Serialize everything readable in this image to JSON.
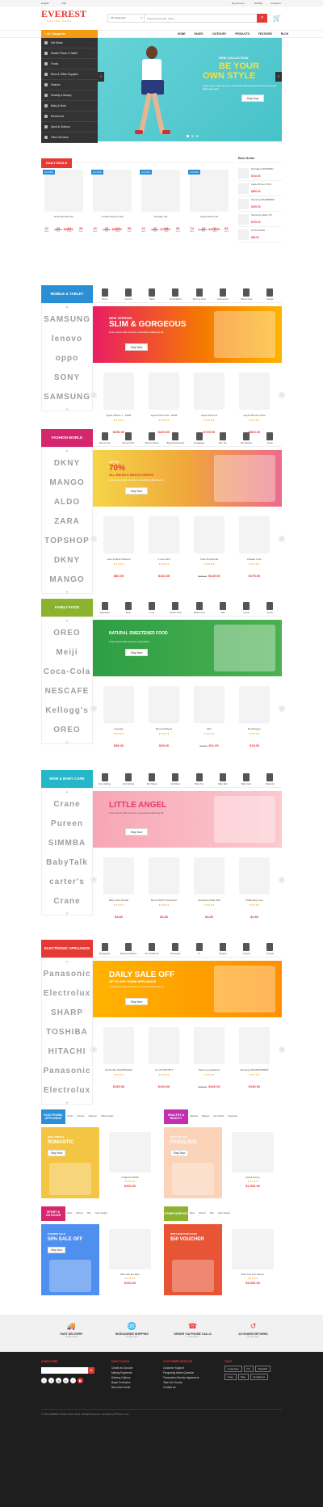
{
  "topbar": {
    "language": "English",
    "currency": "USD",
    "my_account": "My Account",
    "wishlist": "Wishlist",
    "checkout": "Checkout"
  },
  "header": {
    "logo": "EVEREST",
    "logo_sub": "ONLINE SHOP",
    "category_select": "All Categories",
    "search_placeholder": "Keyword here item name..."
  },
  "nav": {
    "all_categories": "All Categories",
    "links": [
      "HOME",
      "PAGES",
      "CATEGORY",
      "PRODUCTS",
      "FEATURES",
      "BLOG"
    ]
  },
  "sidebar": [
    "Hot Deals",
    "Mobile Phone & Tablet",
    "Foods",
    "Book & Office Supplies",
    "Fashion",
    "Healthy & Beauty",
    "Baby & Mom",
    "Electronics",
    "Sport & Outdoor",
    "Other Services"
  ],
  "hero": {
    "kicker": "NEW COLLECTION",
    "title1": "BE YOUR",
    "title2": "OWN STYLE",
    "desc": "Lorem ipsum dolor sit amet, consectetur adipiscing elit. Aenean commodo ligula eget dolor.",
    "button": "Shop Now"
  },
  "daily": {
    "title": "DAILY DEALS",
    "items": [
      {
        "badge": "Cut 15%",
        "name": "Embroidered Polo",
        "old": "$90.00",
        "price": "$85.00",
        "timer": [
          "21",
          "23",
          "34",
          "56"
        ]
      },
      {
        "badge": "Cut 15%",
        "name": "2 Pack Gobermental",
        "old": "$90.00",
        "price": "$85.00",
        "timer": [
          "21",
          "23",
          "34",
          "56"
        ]
      },
      {
        "badge": "Cut 15%",
        "name": "Si Rigby Cat",
        "old": "$90.00",
        "price": "$75.00",
        "timer": [
          "21",
          "23",
          "34",
          "56"
        ]
      },
      {
        "badge": "Cut 15%",
        "name": "Apple iPhone 6S",
        "old": "$190.00",
        "price": "$115.00",
        "timer": [
          "74",
          "23",
          "34",
          "56"
        ]
      }
    ],
    "timer_labels": [
      "Days",
      "Hrs",
      "Mins",
      "Secs"
    ]
  },
  "bestseller": {
    "title": "Best Seller",
    "items": [
      {
        "name": "LB Gallery IPS295IM2",
        "price": "$740.00"
      },
      {
        "name": "Apple iPhone 6 Plus",
        "price": "$890.00"
      },
      {
        "name": "Samsung RF29EBEBR",
        "price": "$190.00"
      },
      {
        "name": "Samsung Galaxy S6",
        "price": "$720.00"
      },
      {
        "name": "HP 32 INKED",
        "price": "$89.00"
      }
    ]
  },
  "sections": [
    {
      "key": "mobile",
      "title": "MOBILE & TABLET",
      "color": "#2b8fd6",
      "cats": [
        "Phone",
        "Android",
        "Tablet",
        "Smart Watch",
        "Memory Card",
        "Accessories",
        "Phone Case",
        "Gadget"
      ],
      "brands": [
        "SAMSUNG",
        "lenovo",
        "oppo",
        "SONY",
        "SAMSUNG"
      ],
      "banner": {
        "kicker": "NEW VERSION",
        "title": "SLIM & GORGEOUS",
        "desc": "Lorem ipsum dolor sit amet, consectetur adipiscing elit.",
        "button": "Shop Now"
      },
      "products": [
        {
          "name": "Apple iPhone 7 - 16GB",
          "old": "",
          "price": "$350.00"
        },
        {
          "name": "Apple iPhone 6S - 16GB",
          "old": "",
          "price": "$420.00"
        },
        {
          "name": "Apple iPhone 6",
          "old": "",
          "price": "$725.00"
        },
        {
          "name": "Apple iPhone 6 Plus",
          "old": "",
          "price": "$860.00"
        }
      ]
    },
    {
      "key": "fashion",
      "title": "FASHION WORLD",
      "color": "#d6266e",
      "cats": [
        "Women Top",
        "Women Pant",
        "Women Shoes",
        "Bag & Accessories",
        "Sunglasses",
        "Men Top",
        "Men Bottom",
        "Dress"
      ],
      "brands": [
        "DKNY",
        "MANGO",
        "ALDO",
        "ZARA",
        "TOPSHOP",
        "DKNY",
        "MANGO"
      ],
      "banner": {
        "kicker": "UP TO",
        "title": "70%",
        "sub": "ALL BIKINI & BEACH DRESS",
        "desc": "Lorem ipsum dolor sit amet, consectetur adipiscing elit.",
        "button": "Shop Now"
      },
      "products": [
        {
          "name": "Lace & Mesh Patterns",
          "old": "",
          "price": "$80.00"
        },
        {
          "name": "A Line Skirt",
          "old": "",
          "price": "$110.00"
        },
        {
          "name": "Crab Printed Hat",
          "old": "$150.00",
          "price": "$149.00"
        },
        {
          "name": "Pleated Front",
          "old": "",
          "price": "$175.00"
        }
      ]
    },
    {
      "key": "food",
      "title": "FAMILY FOOD",
      "color": "#8bb32e",
      "cats": [
        "Vegetables",
        "Meat",
        "Fruit",
        "Frozen Food",
        "Bread Food",
        "Milk",
        "Candy",
        "Snack"
      ],
      "brands": [
        "OREO",
        "Meiji",
        "Coca-Cola",
        "NESCAFE",
        "Kellogg's",
        "OREO"
      ],
      "banner": {
        "kicker": "",
        "title": "NATURAL SWEETENED FOOD",
        "desc": "Lorem ipsum dolor sit amet, consectetur.",
        "button": "Shop Now"
      },
      "products": [
        {
          "name": "Avocado",
          "old": "",
          "price": "$58.00"
        },
        {
          "name": "Broccoli Bread",
          "old": "",
          "price": "$45.00"
        },
        {
          "name": "Mint",
          "old": "$19.00",
          "price": "$11.00"
        },
        {
          "name": "Red Pepper",
          "old": "",
          "price": "$15.00"
        }
      ]
    },
    {
      "key": "baby",
      "title": "MOM & BABY CARE",
      "color": "#26b6c9",
      "cats": [
        "Boy Clothing",
        "Girl Clothing",
        "Boy Shoes",
        "Girl Shoes",
        "Baby Toy",
        "Baby Bed",
        "Baby Care",
        "Maternity"
      ],
      "brands": [
        "Crane",
        "Pureen",
        "SIMMBA",
        "BabyTalk",
        "carter's",
        "Crane"
      ],
      "banner": {
        "kicker": "",
        "title": "LITTLE ANGEL",
        "desc": "Lorem ipsum dolor sit amet, consectetur adipiscing elit.",
        "button": "Shop Now"
      },
      "products": [
        {
          "name": "Baby Girls Sandal",
          "old": "",
          "price": "$4.80"
        },
        {
          "name": "Men's PRINT Swimshort",
          "old": "",
          "price": "$4.80"
        },
        {
          "name": "Grandpa's Plaid Shirt",
          "old": "",
          "price": "$4.80"
        },
        {
          "name": "Plaids Boys Tee",
          "old": "",
          "price": "$4.80"
        }
      ]
    },
    {
      "key": "electronic",
      "title": "ELECTRONIC APPLIANCE",
      "color": "#e53935",
      "cats": [
        "Refrigerator",
        "Washing Machine",
        "Air Conditioner",
        "Microwave",
        "TV",
        "Speaker",
        "Camera",
        "Console"
      ],
      "brands": [
        "Panasonic",
        "Electrolux",
        "SHARP",
        "TOSHIBA",
        "HITACHI",
        "Panasonic",
        "Electrolux"
      ],
      "banner": {
        "kicker": "",
        "title": "DAILY SALE OFF",
        "sub": "UP TO 20% HOME APPLIANCE",
        "desc": "Lorem ipsum dolor sit amet, consectetur adipiscing elit.",
        "button": "Shop Now"
      },
      "products": [
        {
          "name": "GE Profile PFE28RSHSS",
          "old": "",
          "price": "$190.00"
        },
        {
          "name": "LG LFX25978ST",
          "old": "",
          "price": "$190.00"
        },
        {
          "name": "Samsung Appliance",
          "old": "$480.00",
          "price": "$400.00"
        },
        {
          "name": "Samsung RF28HFEDBSR",
          "old": "",
          "price": "$190.00"
        }
      ]
    }
  ],
  "minis": [
    {
      "title": "ELECTRONIC APPLIANCE",
      "color": "#2b8fd6",
      "tabs": [
        "Comic",
        "Science",
        "Stationer",
        "Office Supply"
      ],
      "bkick": "NEW ARRIVAL",
      "btitle": "ROMANTIC",
      "bbtn": "Shop Now",
      "bg": "#f4c542",
      "prod": "Organizer BCIB",
      "price": "$160.00"
    },
    {
      "title": "HEALTHY & BEAUTY",
      "color": "#c22fb0",
      "tabs": [
        "Skincare",
        "Makeup",
        "Hair Health",
        "Fragrance"
      ],
      "bkick": "BEST SELLER",
      "btitle": "FABULOUS",
      "bbtn": "Shop Now",
      "bg": "#fbd3b9",
      "prod": "Facial Serum",
      "price": "$1,500.00"
    },
    {
      "title": "SPORT & OUTDOOR",
      "color": "#d6266e",
      "tabs": [
        "Shoe",
        "Women",
        "Men",
        "Sport Supply"
      ],
      "bkick": "SUMMER SALE",
      "btitle": "50% SALE OFF",
      "bbtn": "Shop Now",
      "bg": "#4f8ff0",
      "prod": "Nike with the Born",
      "price": "$160.00"
    },
    {
      "title": "OTHER SERVICE",
      "color": "#8bb32e",
      "tabs": [
        "Shoe",
        "Women",
        "Men",
        "Sport Supply"
      ],
      "bkick": "WITH $249 PURCHASE",
      "btitle": "$50 VOUCHER",
      "bbtn": "",
      "bg": "#e85535",
      "prod": "Bold Cup and Saucer",
      "price": "$3,500.00"
    }
  ],
  "features": [
    {
      "title": "FAST DELIVERY",
      "sub": "On all orders"
    },
    {
      "title": "WORLDWIDE SHIPPING",
      "sub": "On all orders"
    },
    {
      "title": "ORDER VIA PHONE CALLS",
      "sub": "On all orders"
    },
    {
      "title": "24 HOURS RETURNS",
      "sub": "On all orders"
    }
  ],
  "footer": {
    "subscribe": "SUBSCRIBE",
    "col2": {
      "title": "HOW TO BUY",
      "links": [
        "Create an Account",
        "Making Payments",
        "Delivery Options",
        "Buyer Protection",
        "New User Guide"
      ]
    },
    "col3": {
      "title": "CUSTOMER SERVICE",
      "links": [
        "Customer Support",
        "Frequently Asked Question",
        "Transaction Service Agreement",
        "Take Our Survey",
        "Contact Us"
      ]
    },
    "col4": {
      "title": "TAGS",
      "tags": [
        "Lowercase",
        "Itch",
        "Beautiful",
        "Case",
        "Bag",
        "Sunglasses"
      ]
    },
    "copyright": "© 2016 EVEREST Simple Online Store. All Right Reserved. Template by BTTheme.com"
  },
  "colors": {
    "accent": "#e53935",
    "dark": "#1f1f1f",
    "sidebar": "#333333",
    "orange": "#f39c12"
  }
}
